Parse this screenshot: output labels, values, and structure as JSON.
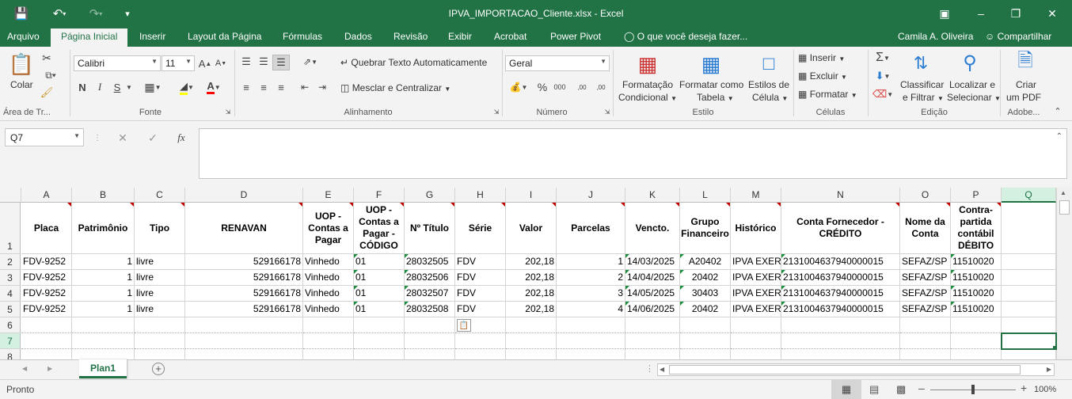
{
  "title": "IPVA_IMPORTACAO_Cliente.xlsx - Excel",
  "tabs": [
    "Arquivo",
    "Página Inicial",
    "Inserir",
    "Layout da Página",
    "Fórmulas",
    "Dados",
    "Revisão",
    "Exibir",
    "Acrobat",
    "Power Pivot"
  ],
  "tell_me": "O que você deseja fazer...",
  "user": "Camila A. Oliveira",
  "share": "Compartilhar",
  "ribbon": {
    "clipboard": {
      "paste": "Colar",
      "group": "Área de Tr..."
    },
    "font": {
      "name": "Calibri",
      "size": "11",
      "bold": "N",
      "italic": "I",
      "underline": "S",
      "group": "Fonte"
    },
    "alignment": {
      "wrap": "Quebrar Texto Automaticamente",
      "merge": "Mesclar e Centralizar",
      "group": "Alinhamento"
    },
    "number": {
      "format": "Geral",
      "group": "Número"
    },
    "styles": {
      "cond1": "Formatação",
      "cond2": "Condicional",
      "table1": "Formatar como",
      "table2": "Tabela",
      "cell1": "Estilos de",
      "cell2": "Célula",
      "group": "Estilo"
    },
    "cells": {
      "insert": "Inserir",
      "delete": "Excluir",
      "format": "Formatar",
      "group": "Células"
    },
    "editing": {
      "sort1": "Classificar",
      "sort2": "e Filtrar",
      "find1": "Localizar e",
      "find2": "Selecionar",
      "group": "Edição"
    },
    "adobe": {
      "pdf1": "Criar",
      "pdf2": "um PDF",
      "group": "Adobe..."
    }
  },
  "namebox": "Q7",
  "columns": [
    "A",
    "B",
    "C",
    "D",
    "E",
    "F",
    "G",
    "H",
    "I",
    "J",
    "K",
    "L",
    "M",
    "N",
    "O",
    "P",
    "Q"
  ],
  "header_row": [
    "Placa",
    "Patrimônio",
    "Tipo",
    "RENAVAN",
    "UOP - Contas a Pagar",
    "UOP - Contas a Pagar - CÓDIGO",
    "Nº Título",
    "Série",
    "Valor",
    "Parcelas",
    "Vencto.",
    "Grupo Financeiro",
    "Histórico",
    "Conta Fornecedor - CRÉDITO",
    "Nome da Conta",
    "Contra-partida contábil DÉBITO",
    ""
  ],
  "rows": [
    [
      "FDV-9252",
      "1",
      "livre",
      "529166178",
      "Vinhedo",
      "01",
      "28032505",
      "FDV",
      "202,18",
      "1",
      "14/03/2025",
      "A20402",
      "IPVA EXER",
      "2131004637940000015",
      "SEFAZ/SP -",
      "11510020",
      ""
    ],
    [
      "FDV-9252",
      "1",
      "livre",
      "529166178",
      "Vinhedo",
      "01",
      "28032506",
      "FDV",
      "202,18",
      "2",
      "14/04/2025",
      "20402",
      "IPVA EXER",
      "2131004637940000015",
      "SEFAZ/SP -",
      "11510020",
      ""
    ],
    [
      "FDV-9252",
      "1",
      "livre",
      "529166178",
      "Vinhedo",
      "01",
      "28032507",
      "FDV",
      "202,18",
      "3",
      "14/05/2025",
      "30403",
      "IPVA EXER",
      "2131004637940000015",
      "SEFAZ/SP -",
      "11510020",
      ""
    ],
    [
      "FDV-9252",
      "1",
      "livre",
      "529166178",
      "Vinhedo",
      "01",
      "28032508",
      "FDV",
      "202,18",
      "4",
      "14/06/2025",
      "20402",
      "IPVA EXER",
      "2131004637940000015",
      "SEFAZ/SP -",
      "11510020",
      ""
    ]
  ],
  "row_numbers": [
    "1",
    "2",
    "3",
    "4",
    "5",
    "6",
    "7",
    "8"
  ],
  "sheet_tab": "Plan1",
  "status": "Pronto",
  "zoom": "100%"
}
